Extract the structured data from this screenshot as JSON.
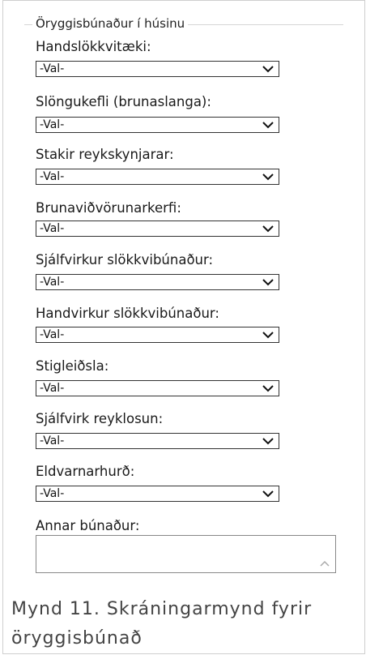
{
  "section": {
    "title": "Öryggisbúnaður í húsinu"
  },
  "fields": [
    {
      "label": "Handslökkvitæki:",
      "value": "-Val-"
    },
    {
      "label": "Slöngukefli (brunaslanga):",
      "value": "-Val-"
    },
    {
      "label": "Stakir reykskynjarar:",
      "value": "-Val-"
    },
    {
      "label": "Brunaviðvörunarkerfi:",
      "value": "-Val-"
    },
    {
      "label": "Sjálfvirkur slökkvibúnaður:",
      "value": "-Val-"
    },
    {
      "label": "Handvirkur slökkvibúnaður:",
      "value": "-Val-"
    },
    {
      "label": "Stigleiðsla:",
      "value": "-Val-"
    },
    {
      "label": "Sjálfvirk reyklosun:",
      "value": "-Val-"
    },
    {
      "label": "Eldvarnarhurð:",
      "value": "-Val-"
    }
  ],
  "other": {
    "label": "Annar búnaður:",
    "value": ""
  },
  "caption": {
    "line1": "Mynd 11. Skráningarmynd fyrir",
    "line2": "öryggisbúnað"
  }
}
